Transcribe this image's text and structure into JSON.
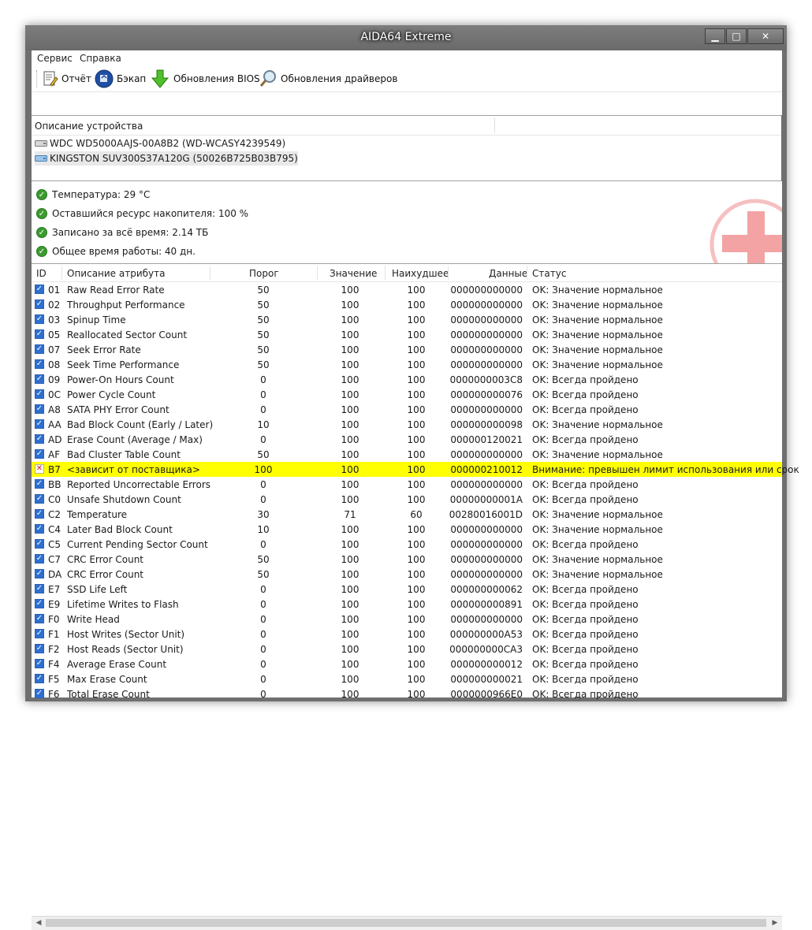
{
  "window": {
    "title": "AIDA64 Extreme",
    "minimize": "▁",
    "maximize": "□",
    "close": "✕"
  },
  "menu": {
    "items": [
      "Сервис",
      "Справка"
    ]
  },
  "toolbar": {
    "report": {
      "label": "Отчёт",
      "icon": "report-icon"
    },
    "backup": {
      "label": "Бэкап",
      "icon": "backup-icon"
    },
    "bios": {
      "label": "Обновления BIOS",
      "icon": "download-arrow-icon"
    },
    "drivers": {
      "label": "Обновления драйверов",
      "icon": "magnifier-icon"
    }
  },
  "devices": {
    "header": "Описание устройства",
    "items": [
      "WDC WD5000AAJS-00A8B2 (WD-WCASY4239549)",
      "KINGSTON SUV300S37A120G (50026B725B03B795)"
    ]
  },
  "info": [
    "Температура: 29 °C",
    "Оставшийся ресурс накопителя: 100 %",
    "Записано за всё время: 2.14 ТБ",
    "Общее время работы: 40 дн."
  ],
  "columns": {
    "id": "ID",
    "name": "Описание атрибута",
    "threshold": "Порог",
    "value": "Значение",
    "worst": "Наихудшее",
    "data": "Данные",
    "status": "Статус"
  },
  "rows": [
    {
      "id": "01",
      "name": "Raw Read Error Rate",
      "thr": "50",
      "val": "100",
      "worst": "100",
      "data": "000000000000",
      "status": "OK: Значение нормальное"
    },
    {
      "id": "02",
      "name": "Throughput Performance",
      "thr": "50",
      "val": "100",
      "worst": "100",
      "data": "000000000000",
      "status": "OK: Значение нормальное"
    },
    {
      "id": "03",
      "name": "Spinup Time",
      "thr": "50",
      "val": "100",
      "worst": "100",
      "data": "000000000000",
      "status": "OK: Значение нормальное"
    },
    {
      "id": "05",
      "name": "Reallocated Sector Count",
      "thr": "50",
      "val": "100",
      "worst": "100",
      "data": "000000000000",
      "status": "OK: Значение нормальное"
    },
    {
      "id": "07",
      "name": "Seek Error Rate",
      "thr": "50",
      "val": "100",
      "worst": "100",
      "data": "000000000000",
      "status": "OK: Значение нормальное"
    },
    {
      "id": "08",
      "name": "Seek Time Performance",
      "thr": "50",
      "val": "100",
      "worst": "100",
      "data": "000000000000",
      "status": "OK: Значение нормальное"
    },
    {
      "id": "09",
      "name": "Power-On Hours Count",
      "thr": "0",
      "val": "100",
      "worst": "100",
      "data": "0000000003C8",
      "status": "OK: Всегда пройдено"
    },
    {
      "id": "0C",
      "name": "Power Cycle Count",
      "thr": "0",
      "val": "100",
      "worst": "100",
      "data": "000000000076",
      "status": "OK: Всегда пройдено"
    },
    {
      "id": "A8",
      "name": "SATA PHY Error Count",
      "thr": "0",
      "val": "100",
      "worst": "100",
      "data": "000000000000",
      "status": "OK: Всегда пройдено"
    },
    {
      "id": "AA",
      "name": "Bad Block Count (Early / Later)",
      "thr": "10",
      "val": "100",
      "worst": "100",
      "data": "000000000098",
      "status": "OK: Значение нормальное"
    },
    {
      "id": "AD",
      "name": "Erase Count (Average / Max)",
      "thr": "0",
      "val": "100",
      "worst": "100",
      "data": "000000120021",
      "status": "OK: Всегда пройдено"
    },
    {
      "id": "AF",
      "name": "Bad Cluster Table Count",
      "thr": "50",
      "val": "100",
      "worst": "100",
      "data": "000000000000",
      "status": "OK: Значение нормальное"
    },
    {
      "id": "B7",
      "name": "<зависит от поставщика>",
      "thr": "100",
      "val": "100",
      "worst": "100",
      "data": "000000210012",
      "status": "Внимание: превышен лимит использования или срок",
      "warn": true
    },
    {
      "id": "BB",
      "name": "Reported Uncorrectable Errors",
      "thr": "0",
      "val": "100",
      "worst": "100",
      "data": "000000000000",
      "status": "OK: Всегда пройдено"
    },
    {
      "id": "C0",
      "name": "Unsafe Shutdown Count",
      "thr": "0",
      "val": "100",
      "worst": "100",
      "data": "00000000001A",
      "status": "OK: Всегда пройдено"
    },
    {
      "id": "C2",
      "name": "Temperature",
      "thr": "30",
      "val": "71",
      "worst": "60",
      "data": "00280016001D",
      "status": "OK: Значение нормальное"
    },
    {
      "id": "C4",
      "name": "Later Bad Block Count",
      "thr": "10",
      "val": "100",
      "worst": "100",
      "data": "000000000000",
      "status": "OK: Значение нормальное"
    },
    {
      "id": "C5",
      "name": "Current Pending Sector Count",
      "thr": "0",
      "val": "100",
      "worst": "100",
      "data": "000000000000",
      "status": "OK: Всегда пройдено"
    },
    {
      "id": "C7",
      "name": "CRC Error Count",
      "thr": "50",
      "val": "100",
      "worst": "100",
      "data": "000000000000",
      "status": "OK: Значение нормальное"
    },
    {
      "id": "DA",
      "name": "CRC Error Count",
      "thr": "50",
      "val": "100",
      "worst": "100",
      "data": "000000000000",
      "status": "OK: Значение нормальное"
    },
    {
      "id": "E7",
      "name": "SSD Life Left",
      "thr": "0",
      "val": "100",
      "worst": "100",
      "data": "000000000062",
      "status": "OK: Всегда пройдено"
    },
    {
      "id": "E9",
      "name": "Lifetime Writes to Flash",
      "thr": "0",
      "val": "100",
      "worst": "100",
      "data": "000000000891",
      "status": "OK: Всегда пройдено"
    },
    {
      "id": "F0",
      "name": "Write Head",
      "thr": "0",
      "val": "100",
      "worst": "100",
      "data": "000000000000",
      "status": "OK: Всегда пройдено"
    },
    {
      "id": "F1",
      "name": "Host Writes (Sector Unit)",
      "thr": "0",
      "val": "100",
      "worst": "100",
      "data": "000000000A53",
      "status": "OK: Всегда пройдено"
    },
    {
      "id": "F2",
      "name": "Host Reads (Sector Unit)",
      "thr": "0",
      "val": "100",
      "worst": "100",
      "data": "000000000CA3",
      "status": "OK: Всегда пройдено"
    },
    {
      "id": "F4",
      "name": "Average Erase Count",
      "thr": "0",
      "val": "100",
      "worst": "100",
      "data": "000000000012",
      "status": "OK: Всегда пройдено"
    },
    {
      "id": "F5",
      "name": "Max Erase Count",
      "thr": "0",
      "val": "100",
      "worst": "100",
      "data": "000000000021",
      "status": "OK: Всегда пройдено"
    },
    {
      "id": "F6",
      "name": "Total Erase Count",
      "thr": "0",
      "val": "100",
      "worst": "100",
      "data": "0000000966E0",
      "status": "OK: Всегда пройдено"
    }
  ],
  "colors": {
    "warning_row": "#ffff00",
    "ok_icon": "#3c9b2f",
    "checkbox": "#2d6fd0",
    "error_mark": "#d01818"
  }
}
